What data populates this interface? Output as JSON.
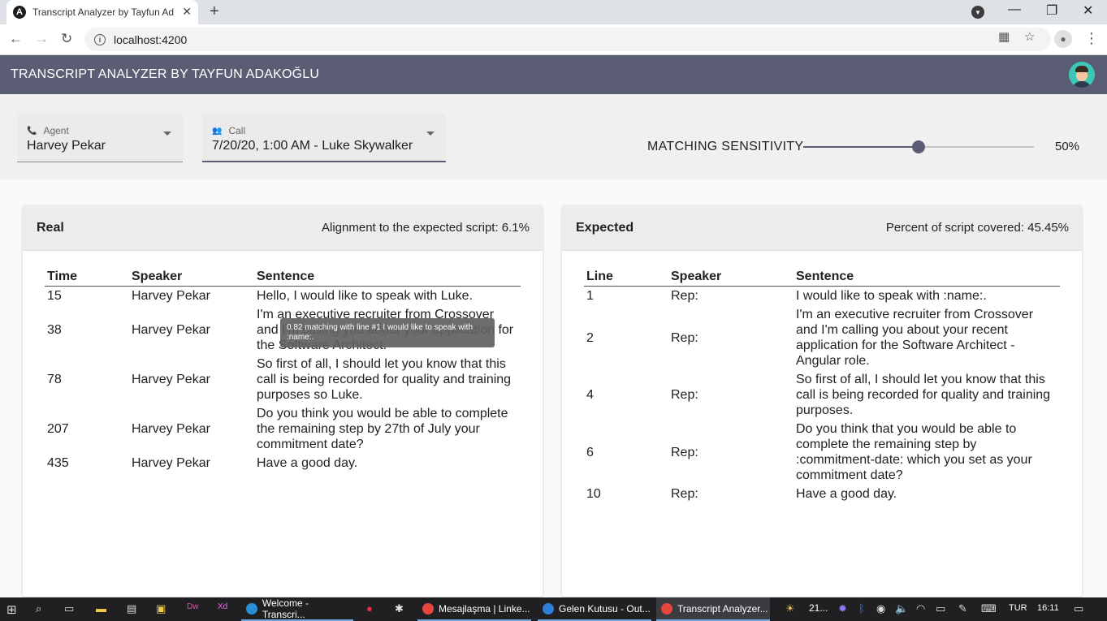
{
  "browser": {
    "tab_title": "Transcript Analyzer by Tayfun Ad",
    "url": "localhost:4200",
    "favicon_letter": "A"
  },
  "app": {
    "title": "TRANSCRIPT ANALYZER BY TAYFUN ADAKOĞLU"
  },
  "controls": {
    "agent_label": "Agent",
    "agent_value": "Harvey Pekar",
    "call_label": "Call",
    "call_value": "7/20/20, 1:00 AM - Luke Skywalker",
    "sensitivity_label": "MATCHING SENSITIVITY",
    "sensitivity_value": "50%",
    "sensitivity_fraction": 0.5
  },
  "real": {
    "title": "Real",
    "stat": "Alignment to the expected script: 6.1%",
    "headers": [
      "Time",
      "Speaker",
      "Sentence"
    ],
    "rows": [
      {
        "time": "15",
        "speaker": "Harvey Pekar",
        "sentence": "Hello, I would like to speak with Luke."
      },
      {
        "time": "38",
        "speaker": "Harvey Pekar",
        "sentence": "I'm an executive recruiter from Crossover and I'm calling you about your application for the Software Architect."
      },
      {
        "time": "78",
        "speaker": "Harvey Pekar",
        "sentence": "So first of all, I should let you know that this call is being recorded for quality and training purposes so Luke."
      },
      {
        "time": "207",
        "speaker": "Harvey Pekar",
        "sentence": "Do you think you would be able to complete the remaining step by 27th of July your commitment date?"
      },
      {
        "time": "435",
        "speaker": "Harvey Pekar",
        "sentence": "Have a good day."
      }
    ]
  },
  "expected": {
    "title": "Expected",
    "stat": "Percent of script covered: 45.45%",
    "headers": [
      "Line",
      "Speaker",
      "Sentence"
    ],
    "rows": [
      {
        "line": "1",
        "speaker": "Rep:",
        "sentence": "I would like to speak with :name:."
      },
      {
        "line": "2",
        "speaker": "Rep:",
        "sentence": "I'm an executive recruiter from Crossover and I'm calling you about your recent application for the Software Architect - Angular role."
      },
      {
        "line": "4",
        "speaker": "Rep:",
        "sentence": "So first of all, I should let you know that this call is being recorded for quality and training purposes."
      },
      {
        "line": "6",
        "speaker": "Rep:",
        "sentence": "Do you think that you would be able to complete the remaining step by :commitment-date: which you set as your commitment date?"
      },
      {
        "line": "10",
        "speaker": "Rep:",
        "sentence": "Have a good day."
      }
    ]
  },
  "tooltip": "0.82 matching with line #1 I would like to speak with :name:.",
  "taskbar": {
    "apps": [
      "Welcome - Transcri...",
      "Mesajlaşma | Linke...",
      "Gelen Kutusu - Out...",
      "Transcript Analyzer..."
    ],
    "weather": "21...",
    "lang": "TUR",
    "time": "16:11"
  }
}
